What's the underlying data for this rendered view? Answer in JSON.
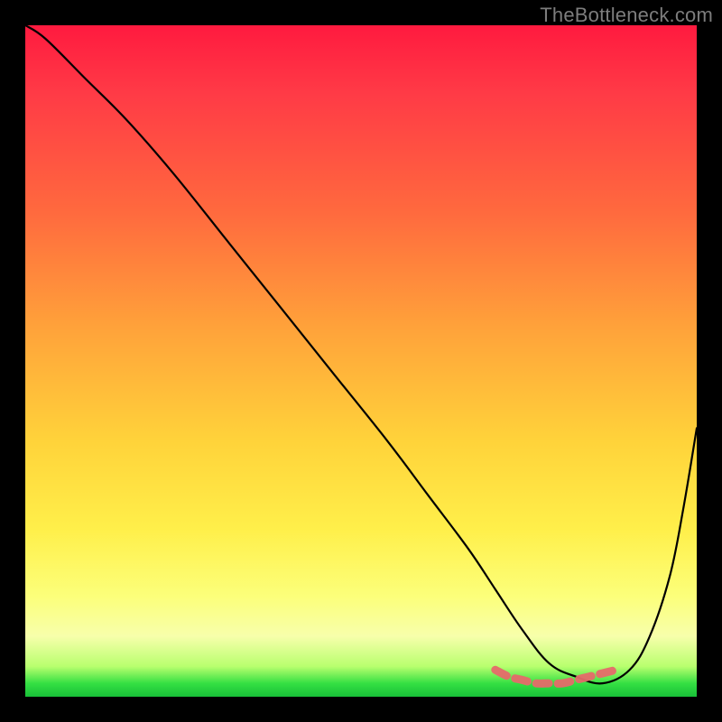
{
  "watermark": "TheBottleneck.com",
  "chart_data": {
    "type": "line",
    "title": "",
    "xlabel": "",
    "ylabel": "",
    "xlim": [
      0,
      100
    ],
    "ylim": [
      0,
      100
    ],
    "grid": false,
    "series": [
      {
        "name": "bottleneck-curve",
        "color": "#000000",
        "x": [
          0,
          3,
          9,
          15,
          22,
          30,
          38,
          46,
          54,
          60,
          66,
          70,
          74,
          78,
          82,
          86,
          90,
          93,
          96,
          98,
          100
        ],
        "values": [
          100,
          98,
          92,
          86,
          78,
          68,
          58,
          48,
          38,
          30,
          22,
          16,
          10,
          5,
          3,
          2,
          4,
          9,
          18,
          28,
          40
        ]
      },
      {
        "name": "optimal-range-marker",
        "color": "#e66a6a",
        "x": [
          70,
          72,
          74,
          76,
          78,
          80,
          82,
          84,
          86,
          88
        ],
        "values": [
          4,
          3,
          2.5,
          2,
          2,
          2,
          2.5,
          3,
          3.5,
          4
        ]
      }
    ],
    "background_gradient": {
      "stops": [
        {
          "pct": 0,
          "color": "#ff1a3f"
        },
        {
          "pct": 10,
          "color": "#ff3a46"
        },
        {
          "pct": 28,
          "color": "#ff6a3e"
        },
        {
          "pct": 45,
          "color": "#ffa23a"
        },
        {
          "pct": 62,
          "color": "#ffd33a"
        },
        {
          "pct": 75,
          "color": "#ffef4a"
        },
        {
          "pct": 85,
          "color": "#fcff7a"
        },
        {
          "pct": 91,
          "color": "#f7ffab"
        },
        {
          "pct": 95.5,
          "color": "#b8ff6e"
        },
        {
          "pct": 98,
          "color": "#35e043"
        },
        {
          "pct": 100,
          "color": "#18c038"
        }
      ]
    }
  }
}
